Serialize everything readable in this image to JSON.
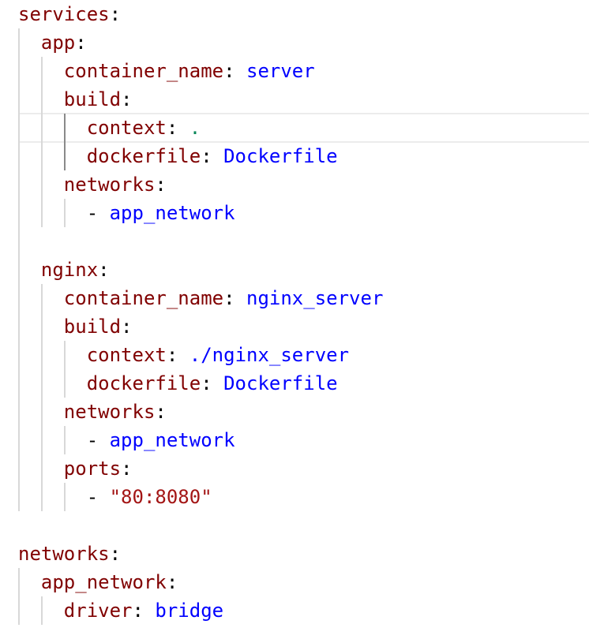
{
  "editor": {
    "language": "yaml",
    "active_line": 4,
    "colors": {
      "key": "#800000",
      "value": "#0000ff",
      "string": "#a31515",
      "dot": "#098658"
    },
    "lines": [
      {
        "indent": "",
        "key": "services"
      },
      {
        "indent": "  ",
        "key": "app"
      },
      {
        "indent": "    ",
        "key": "container_name",
        "value": "server",
        "type": "val"
      },
      {
        "indent": "    ",
        "key": "build"
      },
      {
        "indent": "      ",
        "key": "context",
        "value": ".",
        "type": "num"
      },
      {
        "indent": "      ",
        "key": "dockerfile",
        "value": "Dockerfile",
        "type": "val"
      },
      {
        "indent": "    ",
        "key": "networks"
      },
      {
        "indent": "      ",
        "dash": true,
        "value": "app_network",
        "type": "val"
      },
      {
        "indent": ""
      },
      {
        "indent": "  ",
        "key": "nginx"
      },
      {
        "indent": "    ",
        "key": "container_name",
        "value": "nginx_server",
        "type": "val"
      },
      {
        "indent": "    ",
        "key": "build"
      },
      {
        "indent": "      ",
        "key": "context",
        "value": "./nginx_server",
        "type": "val"
      },
      {
        "indent": "      ",
        "key": "dockerfile",
        "value": "Dockerfile",
        "type": "val"
      },
      {
        "indent": "    ",
        "key": "networks"
      },
      {
        "indent": "      ",
        "dash": true,
        "value": "app_network",
        "type": "val"
      },
      {
        "indent": "    ",
        "key": "ports"
      },
      {
        "indent": "      ",
        "dash": true,
        "value": "\"80:8080\"",
        "type": "str"
      },
      {
        "indent": ""
      },
      {
        "indent": "",
        "key": "networks"
      },
      {
        "indent": "  ",
        "key": "app_network"
      },
      {
        "indent": "    ",
        "key": "driver",
        "value": "bridge",
        "type": "val"
      }
    ]
  }
}
